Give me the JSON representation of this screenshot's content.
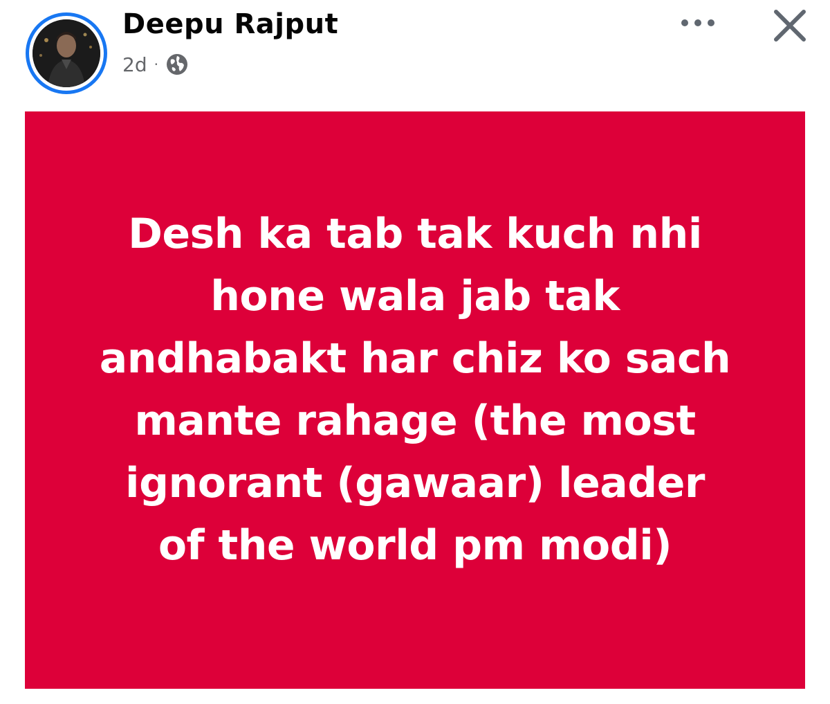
{
  "post": {
    "author": "Deepu Rajput",
    "time": "2d",
    "separator": "·",
    "privacy_icon": "globe-icon",
    "more_icon": "more-dots-icon",
    "close_icon": "close-icon",
    "avatar_ring_color": "#1877f2",
    "card_color": "#dd0039",
    "text_color": "#ffffff",
    "text_lines": [
      "Desh ka tab tak kuch nhi",
      "hone wala jab tak",
      "andhabakt har chiz ko sach",
      "mante rahage (the most",
      "ignorant (gawaar) leader",
      "of the world pm modi)"
    ]
  }
}
